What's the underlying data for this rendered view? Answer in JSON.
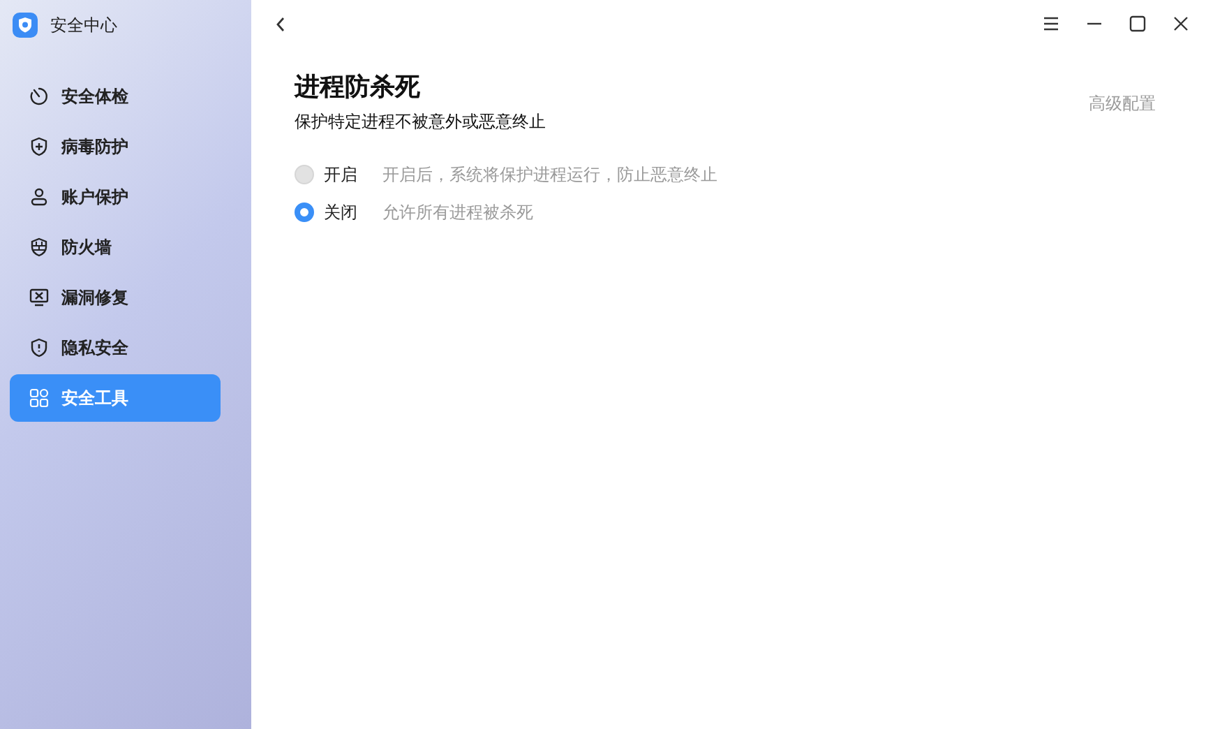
{
  "app": {
    "title": "安全中心"
  },
  "sidebar": {
    "items": [
      {
        "kind": "scan",
        "label": "安全体检",
        "selected": false
      },
      {
        "kind": "virus",
        "label": "病毒防护",
        "selected": false
      },
      {
        "kind": "account",
        "label": "账户保护",
        "selected": false
      },
      {
        "kind": "firewall",
        "label": "防火墙",
        "selected": false
      },
      {
        "kind": "repair",
        "label": "漏洞修复",
        "selected": false
      },
      {
        "kind": "privacy",
        "label": "隐私安全",
        "selected": false
      },
      {
        "kind": "tools",
        "label": "安全工具",
        "selected": true
      }
    ]
  },
  "page": {
    "title": "进程防杀死",
    "subtitle": "保护特定进程不被意外或恶意终止",
    "advanced": {
      "label": "高级配置",
      "disabled": true
    },
    "options": [
      {
        "label": "开启",
        "description": "开启后，系统将保护进程运行，防止恶意终止",
        "selected": false
      },
      {
        "label": "关闭",
        "description": "允许所有进程被杀死",
        "selected": true
      }
    ]
  }
}
